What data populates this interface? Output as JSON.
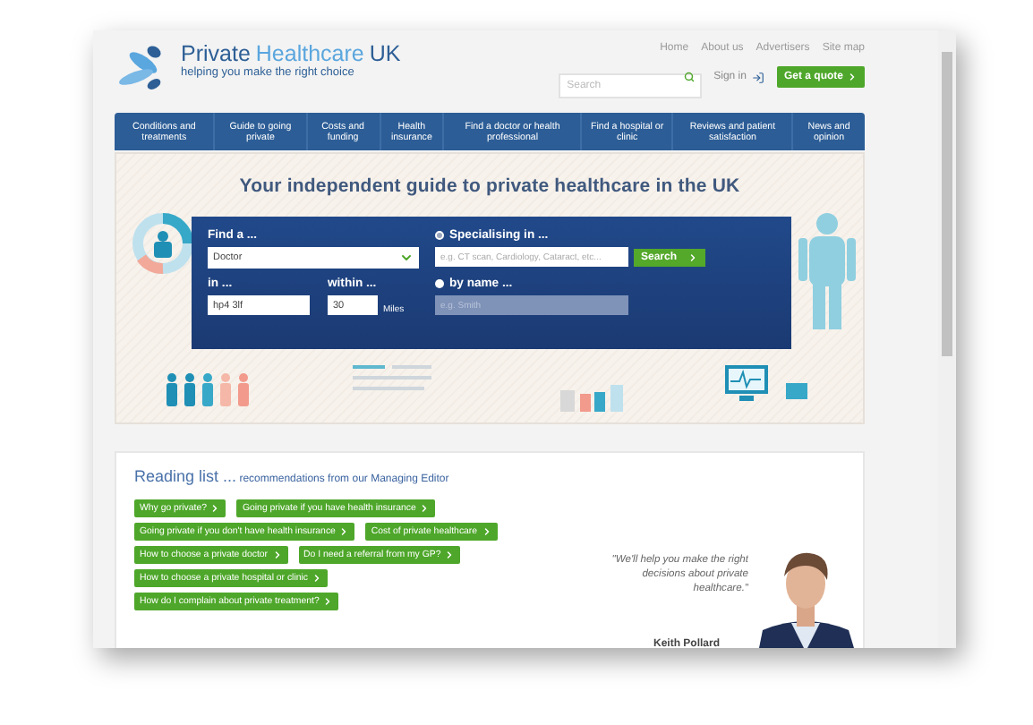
{
  "header": {
    "logo": {
      "title_parts": [
        "Private",
        "Healthcare",
        "UK"
      ],
      "tagline": "helping you make the right choice"
    },
    "top_links": [
      "Home",
      "About us",
      "Advertisers",
      "Site map"
    ],
    "search": {
      "placeholder": "Search"
    },
    "sign_in": "Sign in",
    "quote_button": "Get a quote"
  },
  "nav": [
    "Conditions and treatments",
    "Guide to going private",
    "Costs and funding",
    "Health insurance",
    "Find a doctor or health professional",
    "Find a hospital or clinic",
    "Reviews and patient satisfaction",
    "News and opinion"
  ],
  "hero": {
    "title": "Your independent guide to private healthcare in the UK",
    "finder": {
      "find_label": "Find a ...",
      "find_value": "Doctor",
      "in_label": "in ...",
      "in_value": "hp4 3lf",
      "within_label": "within ...",
      "within_value": "30",
      "unit": "Miles",
      "options": [
        {
          "label": "Specialising in ...",
          "selected": true,
          "placeholder": "e.g. CT scan, Cardiology, Cataract, etc...",
          "disabled": false
        },
        {
          "label": "by name ...",
          "selected": false,
          "placeholder": "e.g. Smith",
          "disabled": true
        }
      ],
      "search_button": "Search"
    }
  },
  "reading": {
    "title": "Reading list ...",
    "subtitle": "recommendations from our",
    "link": "Managing Editor",
    "rows": [
      [
        "Why go private?",
        "Going private if you have health insurance"
      ],
      [
        "Going private if you don't have health insurance",
        "Cost of private healthcare"
      ],
      [
        "How to choose a private doctor",
        "Do I need a referral from my GP?"
      ],
      [
        "How to choose a private hospital or clinic"
      ],
      [
        "How do I complain about private treatment?"
      ]
    ],
    "quote": "\"We'll help you make the right decisions about private healthcare.\"",
    "author": "Keith Pollard"
  }
}
